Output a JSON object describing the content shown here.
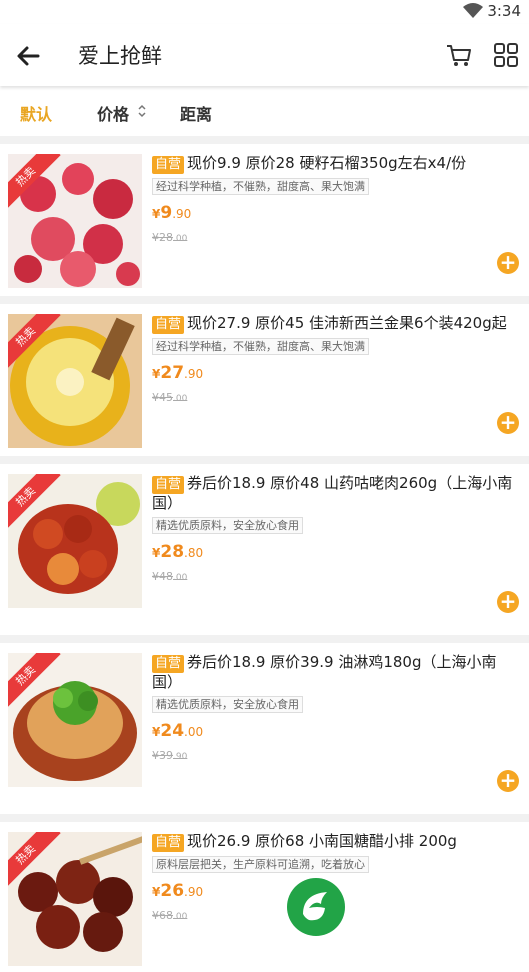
{
  "status": {
    "time": "3:34"
  },
  "header": {
    "title": "爱上抢鲜"
  },
  "filters": [
    {
      "label": "默认",
      "active": true
    },
    {
      "label": "价格",
      "active": false
    },
    {
      "label": "距离",
      "active": false
    }
  ],
  "ribbon": "热卖",
  "colors": {
    "accent": "#f5a623",
    "price": "#f08a1d",
    "ribbon": "#e83a3a",
    "logo": "#22a447"
  },
  "products": [
    {
      "badge": "自营",
      "name": "现价9.9 原价28 硬籽石榴350g左右x4/份",
      "tag": "经过科学种植，不催熟，甜度高、果大饱满",
      "price_symbol": "¥",
      "price_int": "9",
      "price_dec": ".90",
      "orig_symbol": "¥",
      "orig_int": "28",
      "orig_dec": ".00"
    },
    {
      "badge": "自营",
      "name": "现价27.9 原价45 佳沛新西兰金果6个装420g起",
      "tag": "经过科学种植，不催熟，甜度高、果大饱满",
      "price_symbol": "¥",
      "price_int": "27",
      "price_dec": ".90",
      "orig_symbol": "¥",
      "orig_int": "45",
      "orig_dec": ".00"
    },
    {
      "badge": "自营",
      "name": "券后价18.9 原价48 山药咕咾肉260g（上海小南国）",
      "tag": "精选优质原料，安全放心食用",
      "price_symbol": "¥",
      "price_int": "28",
      "price_dec": ".80",
      "orig_symbol": "¥",
      "orig_int": "48",
      "orig_dec": ".00"
    },
    {
      "badge": "自营",
      "name": "券后价18.9 原价39.9 油淋鸡180g（上海小南国）",
      "tag": "精选优质原料，安全放心食用",
      "price_symbol": "¥",
      "price_int": "24",
      "price_dec": ".00",
      "orig_symbol": "¥",
      "orig_int": "39",
      "orig_dec": ".90"
    },
    {
      "badge": "自营",
      "name": "现价26.9 原价68 小南国糖醋小排 200g",
      "tag": "原料层层把关，生产原料可追溯，吃着放心",
      "price_symbol": "¥",
      "price_int": "26",
      "price_dec": ".90",
      "orig_symbol": "¥",
      "orig_int": "68",
      "orig_dec": ".00"
    }
  ]
}
